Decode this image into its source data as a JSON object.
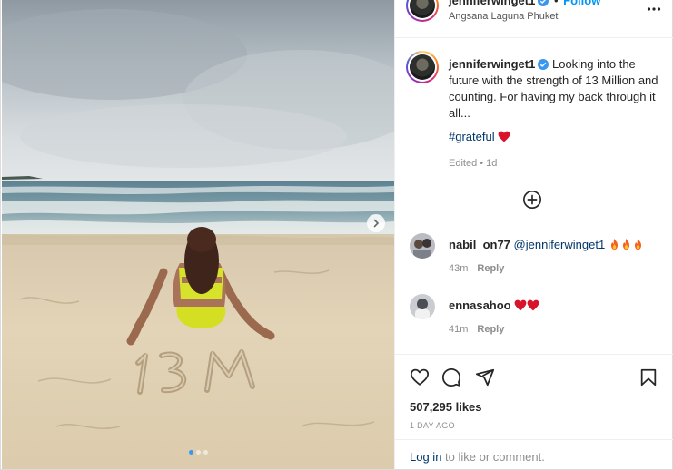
{
  "post": {
    "username": "jenniferwinget1",
    "separator": "•",
    "follow_label": "Follow",
    "location": "Angsana Laguna Phuket",
    "caption": "Looking into the future with the strength of 13 Million and counting. For having my back through it all...",
    "hashtag": "#grateful",
    "edited": "Edited • 1d"
  },
  "comments": [
    {
      "username": "nabil_on77",
      "mention": "@jenniferwinget1",
      "emoji": "fire",
      "time": "43m",
      "reply_label": "Reply"
    },
    {
      "username": "ennasahoo",
      "emoji": "heart",
      "time": "41m",
      "reply_label": "Reply"
    }
  ],
  "stats": {
    "likes": "507,295 likes",
    "posted": "1 DAY AGO"
  },
  "login": {
    "link": "Log in",
    "text": " to like or comment."
  },
  "carousel": {
    "count": 3,
    "active": 1
  },
  "colors": {
    "link_blue": "#0095f6",
    "verified_blue": "#3897f0",
    "heart_red": "#ed4956"
  },
  "icons": [
    "more-icon",
    "verified-icon",
    "heart-icon",
    "comment-icon",
    "share-icon",
    "bookmark-icon",
    "add-circle-icon",
    "chevron-right-icon",
    "fire-icon"
  ]
}
